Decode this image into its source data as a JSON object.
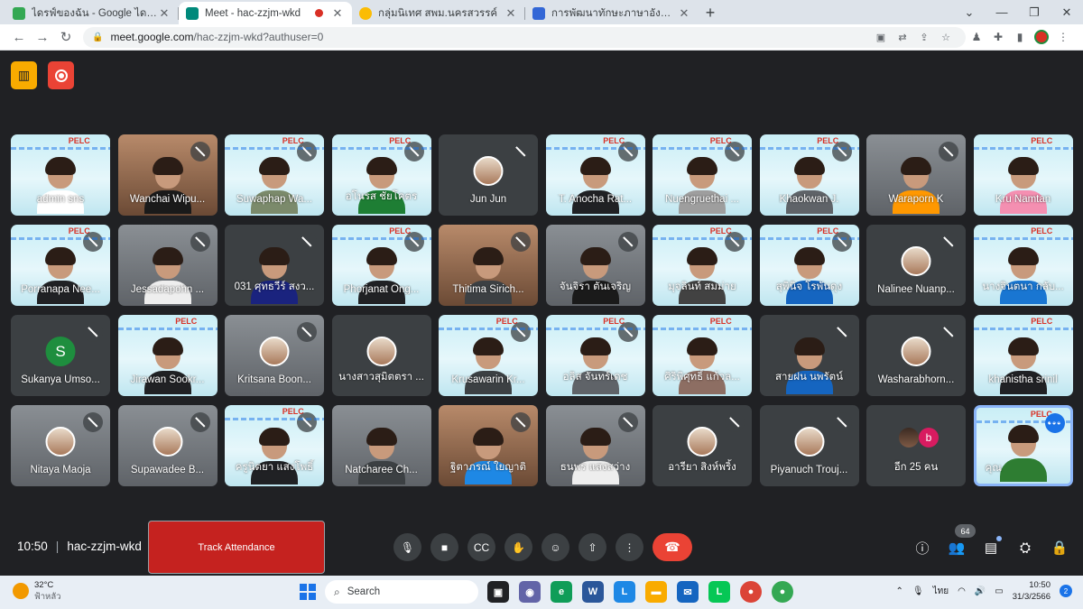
{
  "browser": {
    "tabs": [
      {
        "title": "ไดรฟ์ของฉัน - Google ไดรฟ์",
        "color": "#34a853"
      },
      {
        "title": "Meet - hac-zzjm-wkd",
        "color": "#00897b"
      },
      {
        "title": "กลุ่มนิเทศ สพม.นครสวรรค์",
        "color": "#fbbc04"
      },
      {
        "title": "การพัฒนาทักษะภาษาอังกฤษ English",
        "color": "#3367d6"
      }
    ],
    "url_host": "meet.google.com",
    "url_path": "/hac-zzjm-wkd?authuser=0"
  },
  "participants": [
    {
      "name": "admin sns",
      "style": "slide",
      "muted": false,
      "shirt": "#ffffff"
    },
    {
      "name": "Wanchai Wipu...",
      "style": "warm",
      "muted": true,
      "shirt": "#1a1a1a"
    },
    {
      "name": "Suwaphap Wa...",
      "style": "slide",
      "muted": true,
      "shirt": "#7b8a6b"
    },
    {
      "name": "อโนรส ชัยโคตร",
      "style": "slide",
      "muted": true,
      "shirt": "#1e7e34"
    },
    {
      "name": "Jun Jun",
      "style": "dark",
      "muted": true,
      "avatar": "photo"
    },
    {
      "name": "T. Anocha Rat...",
      "style": "slide",
      "muted": true,
      "shirt": "#202124"
    },
    {
      "name": "Nuengruethai ...",
      "style": "slide",
      "muted": true,
      "shirt": "#9e9e9e"
    },
    {
      "name": "Khaokwan J.",
      "style": "slide",
      "muted": true,
      "shirt": "#5f6368"
    },
    {
      "name": "Waraporn K",
      "style": "cam",
      "muted": true,
      "shirt": "#ff9800"
    },
    {
      "name": "Kru Namtan",
      "style": "slide",
      "muted": false,
      "shirt": "#f48fb1"
    },
    {
      "name": "Porranapa Nee...",
      "style": "slide",
      "muted": true,
      "shirt": "#202124"
    },
    {
      "name": "Jessadapohn ...",
      "style": "cam",
      "muted": true,
      "shirt": "#eeeeee"
    },
    {
      "name": "031 ศุทธวีร์ สงว...",
      "style": "dark",
      "muted": true,
      "shirt": "#1a237e"
    },
    {
      "name": "Phorjanat Ong...",
      "style": "slide",
      "muted": true,
      "shirt": "#202124"
    },
    {
      "name": "Thitima Sirich...",
      "style": "warm",
      "muted": true,
      "shirt": "#3c4043"
    },
    {
      "name": "จันจิรา ตันเจริญ",
      "style": "cam",
      "muted": true,
      "shirt": "#1a1a1a"
    },
    {
      "name": "มุจลินท์ สมม่าย",
      "style": "slide",
      "muted": true,
      "shirt": "#424242"
    },
    {
      "name": "สุพินิจ โรพันดุง",
      "style": "slide",
      "muted": true,
      "shirt": "#1565c0"
    },
    {
      "name": "Nalinee Nuanp...",
      "style": "dark",
      "muted": true,
      "avatar": "photo"
    },
    {
      "name": "นางจินตนา กลับ...",
      "style": "slide",
      "muted": false,
      "shirt": "#1976d2"
    },
    {
      "name": "Sukanya Umso...",
      "style": "dark",
      "muted": true,
      "avatar": "letter",
      "letter": "S"
    },
    {
      "name": "Jirawan Sookr...",
      "style": "slide",
      "muted": false,
      "shirt": "#202124"
    },
    {
      "name": "Kritsana Boon...",
      "style": "cam",
      "muted": true,
      "avatar": "photo"
    },
    {
      "name": "นางสาวสุมิตตรา ...",
      "style": "dark",
      "muted": false,
      "avatar": "photo"
    },
    {
      "name": "Krusawarin Kr...",
      "style": "slide",
      "muted": true,
      "shirt": "#3c4043"
    },
    {
      "name": "อลิส จันทร์เดช",
      "style": "slide",
      "muted": true,
      "shirt": "#5f6368"
    },
    {
      "name": "ศิริพิศุทธิ์ แก้วล...",
      "style": "slide",
      "muted": false,
      "shirt": "#8d6e63"
    },
    {
      "name": "สายฝน นพรัตน์",
      "style": "dark",
      "muted": true,
      "shirt": "#1565c0"
    },
    {
      "name": "Washarabhorn...",
      "style": "dark",
      "muted": true,
      "avatar": "photo"
    },
    {
      "name": "khanistha srinil",
      "style": "slide",
      "muted": false,
      "shirt": "#202124"
    },
    {
      "name": "Nitaya Maoja",
      "style": "cam",
      "muted": true,
      "avatar": "photo"
    },
    {
      "name": "Supawadee B...",
      "style": "cam",
      "muted": true,
      "avatar": "photo"
    },
    {
      "name": "ครูนิตยา แสงโพธิ์",
      "style": "slide",
      "muted": true,
      "shirt": "#202124"
    },
    {
      "name": "Natcharee Ch...",
      "style": "cam",
      "muted": false,
      "shirt": "#3c4043"
    },
    {
      "name": "ฐิตาภรณ์ ใยญาติ",
      "style": "warm",
      "muted": true,
      "shirt": "#1e88e5"
    },
    {
      "name": "ธนพร แสงสว่าง",
      "style": "cam",
      "muted": true,
      "shirt": "#eeeeee"
    },
    {
      "name": "อารียา สิงห์พริ้ง",
      "style": "dark",
      "muted": true,
      "avatar": "photo"
    },
    {
      "name": "Piyanuch Trouj...",
      "style": "dark",
      "muted": true,
      "avatar": "photo"
    }
  ],
  "more_tile": {
    "label": "อีก 25 คน",
    "letter": "b"
  },
  "self_tile": {
    "name": "คุณ"
  },
  "meeting": {
    "time": "10:50",
    "code": "hac-zzjm-wkd"
  },
  "track_button": "Track Attendance",
  "people_count": "64",
  "taskbar": {
    "temp": "32°C",
    "weather": "ฟ้าหลัว",
    "search": "Search",
    "lang": "ไทย",
    "time": "10:50",
    "date": "31/3/2566",
    "notifications": "2"
  },
  "colors": {
    "accent": "#1a73e8",
    "end_call": "#ea4335",
    "track": "#c5221f",
    "meet_bg": "#202124"
  }
}
